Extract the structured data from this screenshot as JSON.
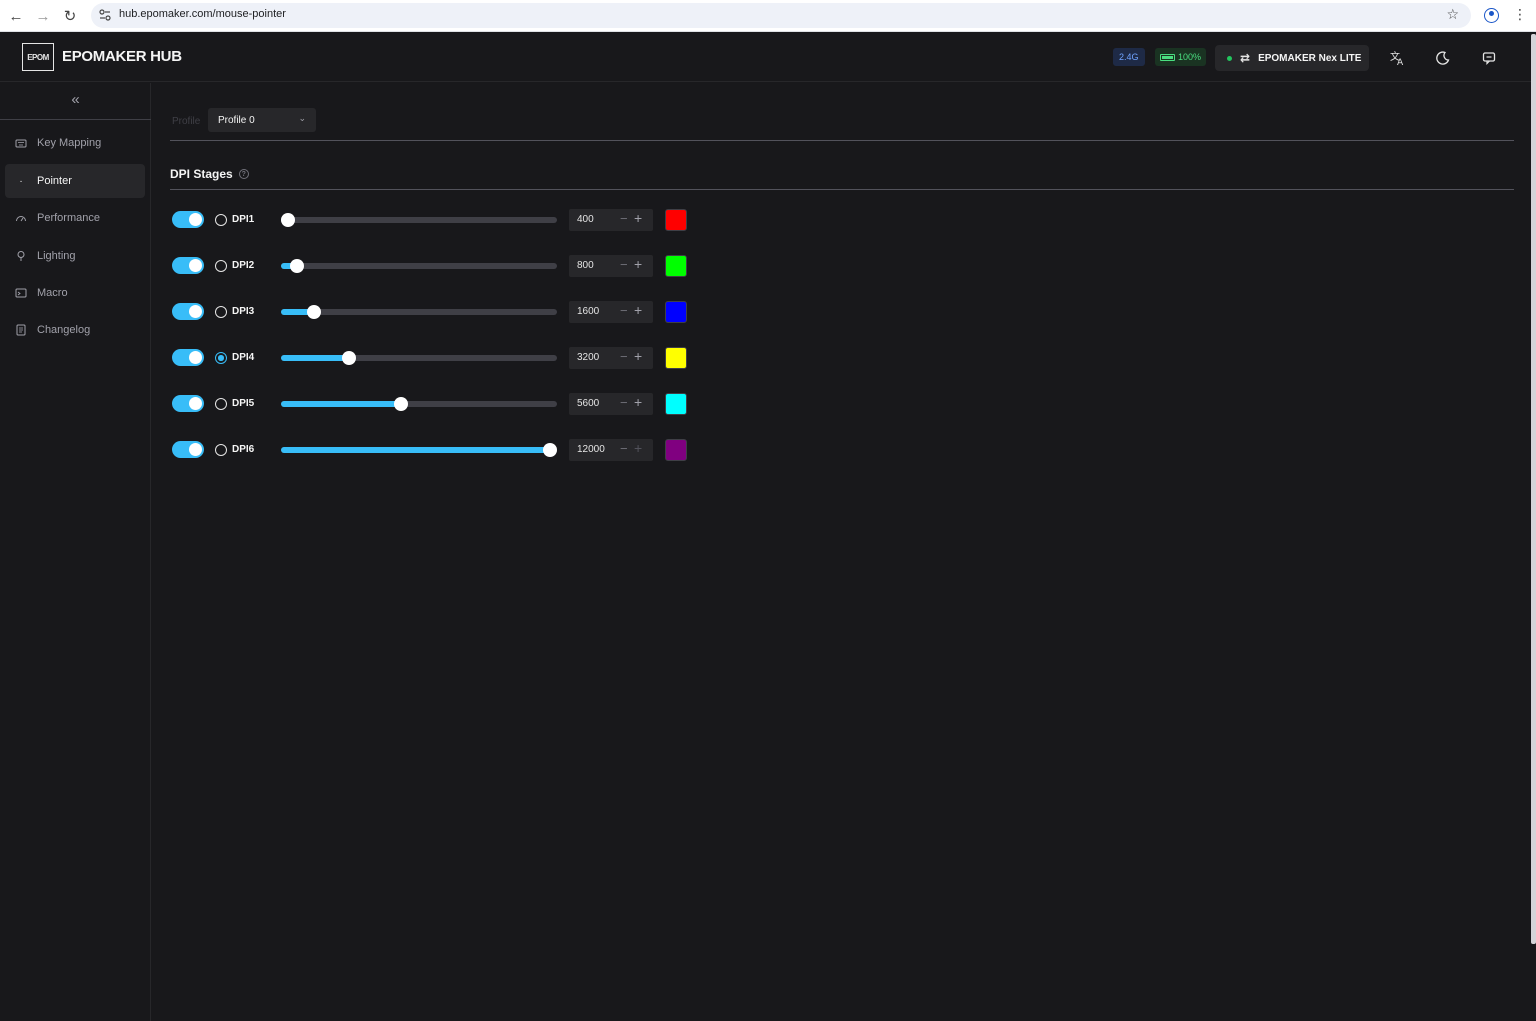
{
  "browser": {
    "url": "hub.epomaker.com/mouse-pointer"
  },
  "header": {
    "logo_text": "EPOM",
    "brand": "EPOMAKER HUB",
    "connection_badge": "2.4G",
    "battery_badge": "100%",
    "device_name": "EPOMAKER Nex LITE"
  },
  "sidebar": {
    "items": [
      {
        "label": "Key Mapping",
        "icon": "keyboard-icon"
      },
      {
        "label": "Pointer",
        "icon": "pointer-icon"
      },
      {
        "label": "Performance",
        "icon": "gauge-icon"
      },
      {
        "label": "Lighting",
        "icon": "bulb-icon"
      },
      {
        "label": "Macro",
        "icon": "macro-icon"
      },
      {
        "label": "Changelog",
        "icon": "document-icon"
      }
    ],
    "active": "Pointer"
  },
  "profile": {
    "label": "Profile",
    "selected": "Profile 0"
  },
  "dpi_section": {
    "title": "DPI Stages",
    "stages": [
      {
        "label": "DPI1",
        "value": "400",
        "enabled": true,
        "selected": false,
        "level": 0.0,
        "color": "#ff0000"
      },
      {
        "label": "DPI2",
        "value": "800",
        "enabled": true,
        "selected": false,
        "level": 0.034,
        "color": "#00ff00"
      },
      {
        "label": "DPI3",
        "value": "1600",
        "enabled": true,
        "selected": false,
        "level": 0.1,
        "color": "#0000ff"
      },
      {
        "label": "DPI4",
        "value": "3200",
        "enabled": true,
        "selected": true,
        "level": 0.233,
        "color": "#ffff00"
      },
      {
        "label": "DPI5",
        "value": "5600",
        "enabled": true,
        "selected": false,
        "level": 0.433,
        "color": "#00ffff"
      },
      {
        "label": "DPI6",
        "value": "12000",
        "enabled": true,
        "selected": false,
        "level": 1.0,
        "color": "#800080"
      }
    ],
    "accent_color": "#38bdf8"
  }
}
